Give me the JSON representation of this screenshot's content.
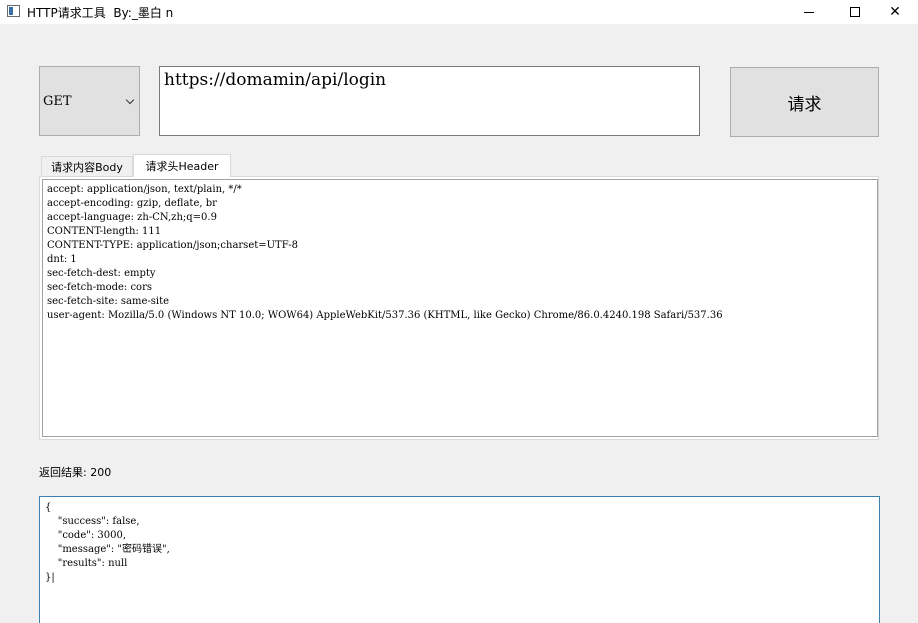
{
  "window": {
    "title": "HTTP请求工具  By:_墨白 n",
    "minimize_glyph": "—",
    "maximize_glyph": "☐",
    "close_glyph": "✕"
  },
  "request": {
    "method": "GET",
    "url": "https://domamin/api/login",
    "button_label": "请求"
  },
  "tabs": [
    {
      "label": "请求内容Body",
      "active": false
    },
    {
      "label": "请求头Header",
      "active": true
    }
  ],
  "headers_text": "accept: application/json, text/plain, */*\naccept-encoding: gzip, deflate, br\naccept-language: zh-CN,zh;q=0.9\nCONTENT-length: 111\nCONTENT-TYPE: application/json;charset=UTF-8\ndnt: 1\nsec-fetch-dest: empty\nsec-fetch-mode: cors\nsec-fetch-site: same-site\nuser-agent: Mozilla/5.0 (Windows NT 10.0; WOW64) AppleWebKit/537.36 (KHTML, like Gecko) Chrome/86.0.4240.198 Safari/537.36",
  "result": {
    "label": "返回结果: 200",
    "body": "{\n    \"success\": false,\n    \"code\": 3000,\n    \"message\": \"密码错误\",\n    \"results\": null\n}|"
  },
  "colors": {
    "background": "#f0f0f0",
    "result_border_accent": "#3c7fb1"
  }
}
